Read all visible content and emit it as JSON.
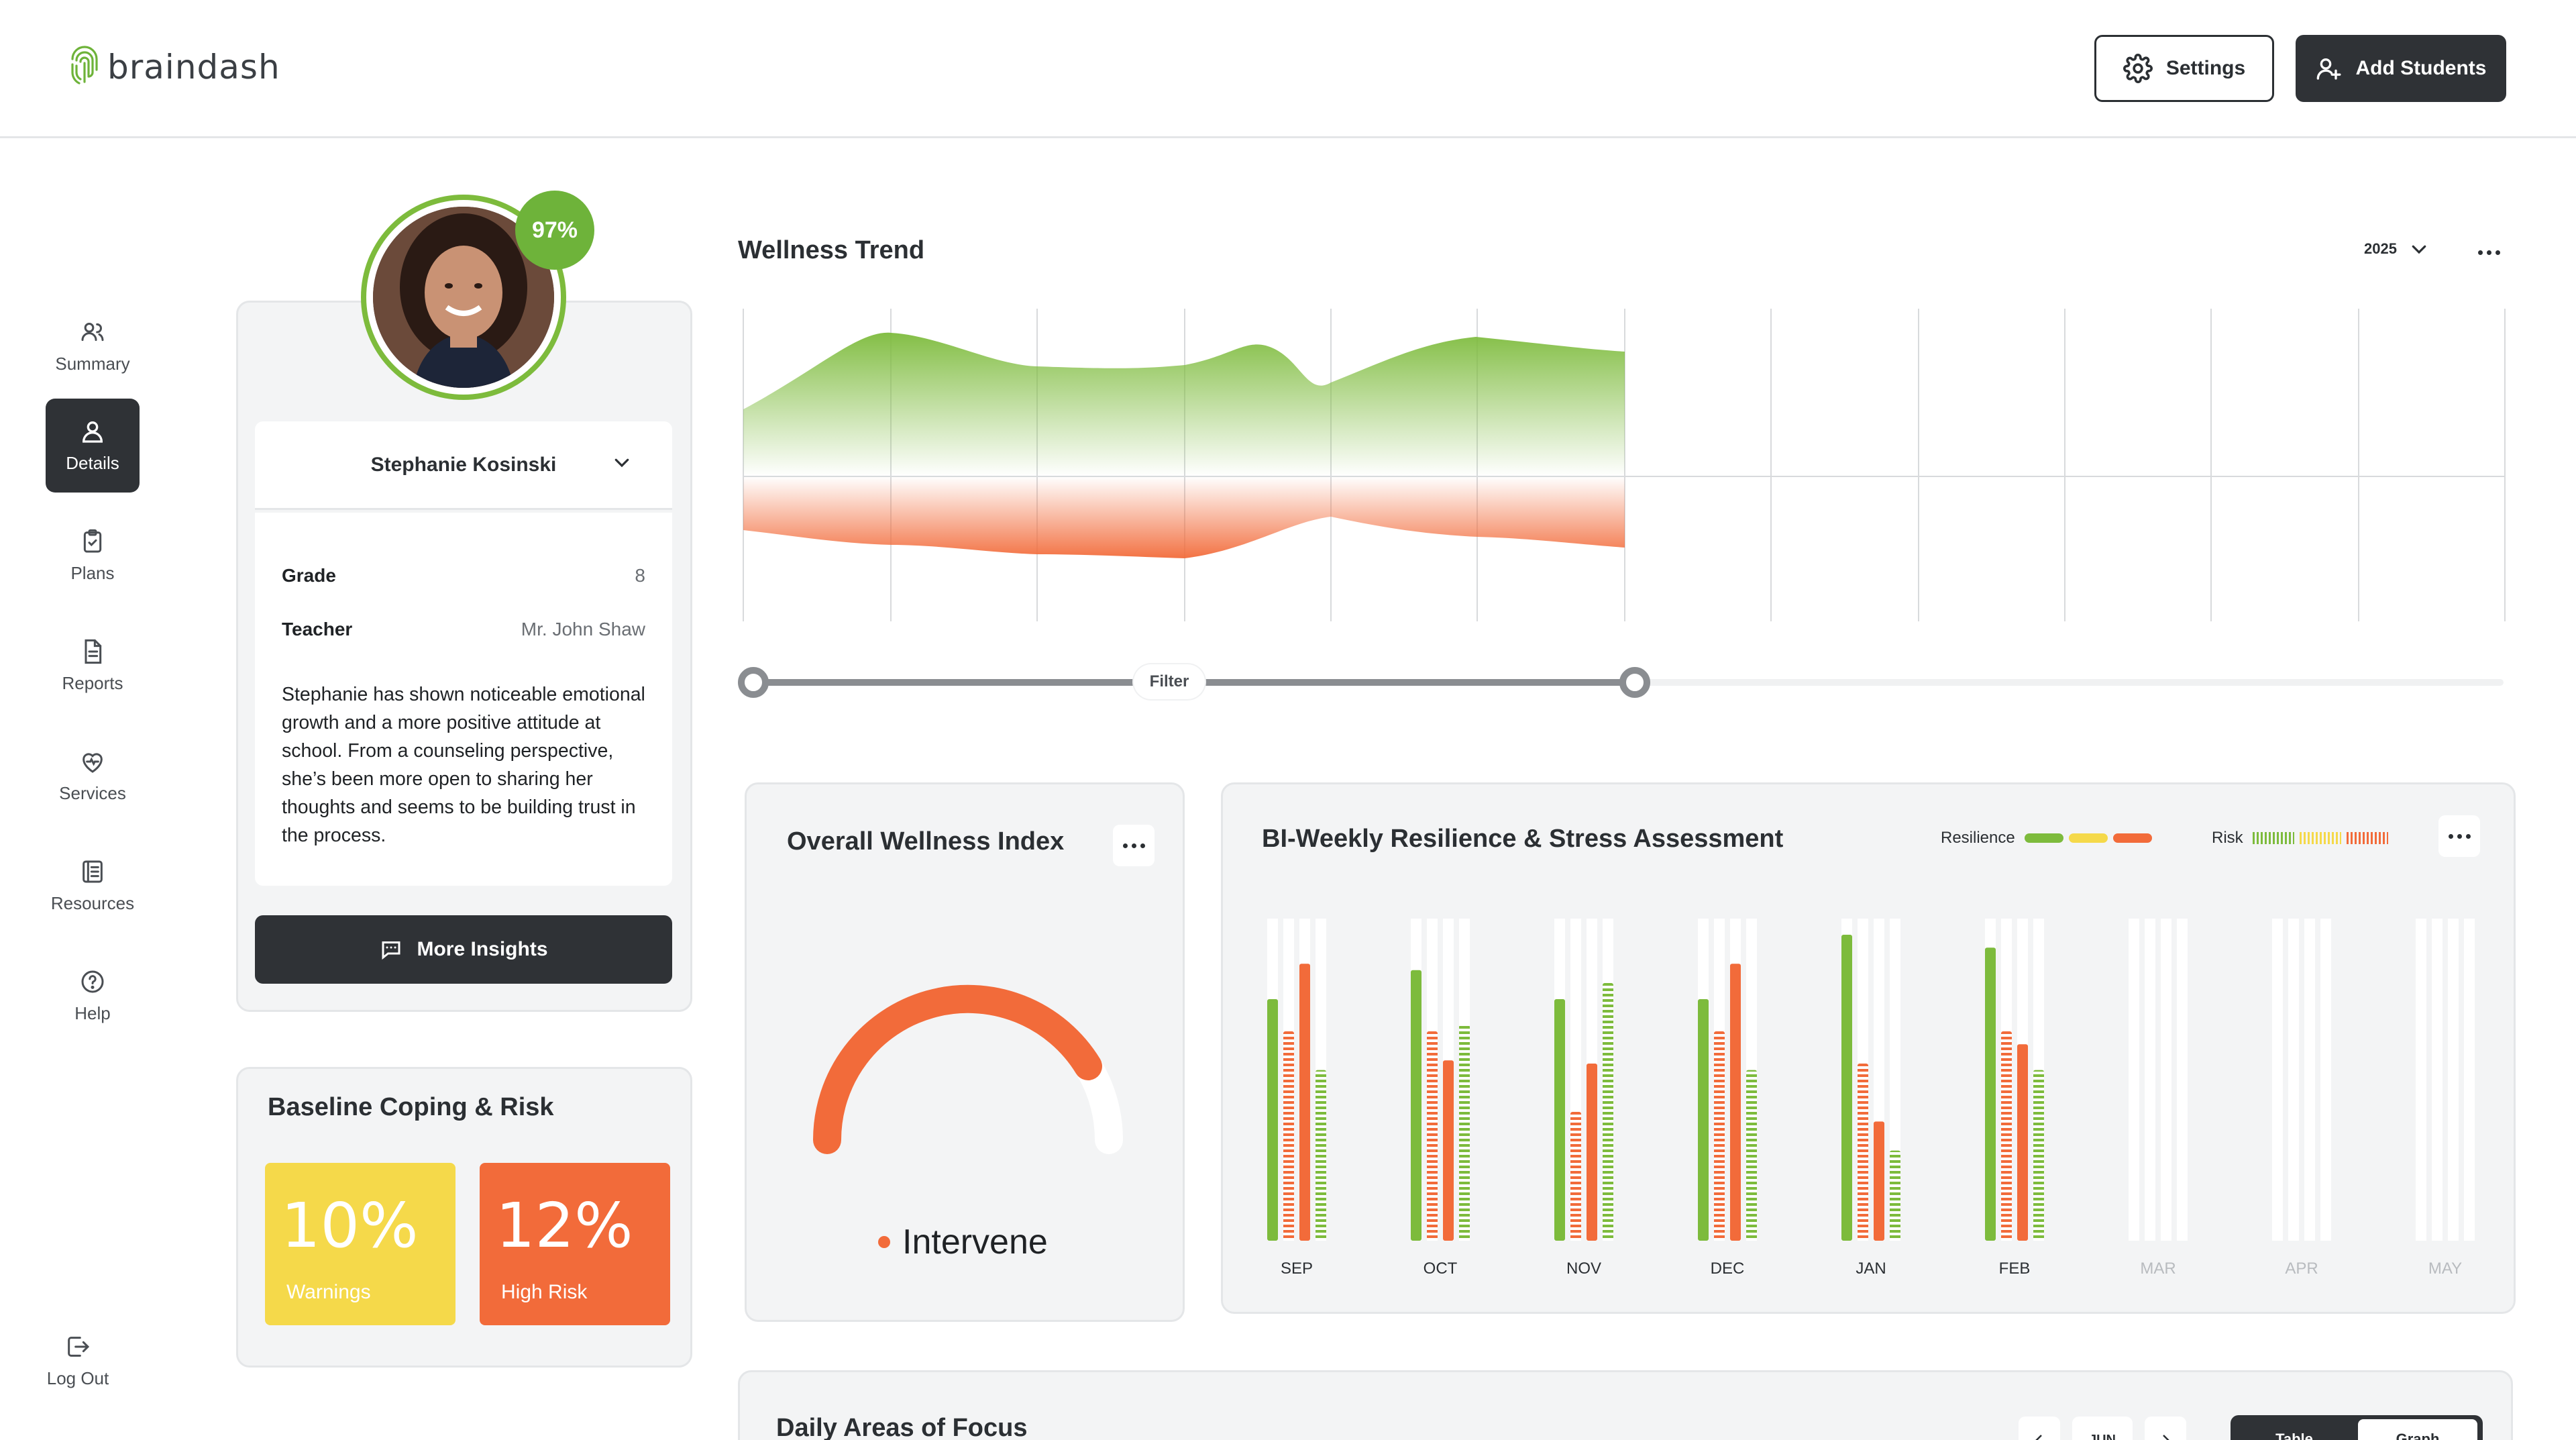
{
  "app": {
    "logo_text": "braindash",
    "settings_label": "Settings",
    "add_students_label": "Add Students"
  },
  "sidebar": {
    "items": [
      {
        "label": "Summary",
        "icon": "users-icon"
      },
      {
        "label": "Details",
        "icon": "user-icon",
        "active": true
      },
      {
        "label": "Plans",
        "icon": "clipboard-check-icon"
      },
      {
        "label": "Reports",
        "icon": "document-icon"
      },
      {
        "label": "Services",
        "icon": "heart-pulse-icon"
      },
      {
        "label": "Resources",
        "icon": "book-icon"
      },
      {
        "label": "Help",
        "icon": "help-icon"
      }
    ],
    "logout_label": "Log Out"
  },
  "profile": {
    "score": "97%",
    "name": "Stephanie Kosinski",
    "grade_label": "Grade",
    "grade_value": "8",
    "teacher_label": "Teacher",
    "teacher_value": "Mr. John Shaw",
    "bio": "Stephanie has shown noticeable emotional growth and a more positive attitude at school. From a counseling perspective, she’s been more open to sharing her thoughts and seems to be building trust in the process.",
    "insights_label": "More Insights"
  },
  "baseline": {
    "title": "Baseline Coping & Risk",
    "warnings_value": "10%",
    "warnings_label": "Warnings",
    "high_risk_value": "12%",
    "high_risk_label": "High Risk",
    "colors": {
      "warnings": "#f5d94a",
      "high_risk": "#f26b3a"
    }
  },
  "wellness_trend": {
    "title": "Wellness Trend",
    "year": "2025",
    "filter_label": "Filter",
    "colors": {
      "positive": "#7dbb3c",
      "negative": "#f26b3a"
    }
  },
  "overall_wellness": {
    "title": "Overall Wellness Index",
    "status": "Intervene",
    "level": 0.88,
    "color": "#f26b3a"
  },
  "resilience": {
    "title": "BI-Weekly Resilience & Stress Assessment",
    "legend_resilience": "Resilience",
    "legend_risk": "Risk",
    "colors": {
      "green": "#7dbb3c",
      "yellow": "#f5d94a",
      "orange": "#f26b3a"
    }
  },
  "chart_data": {
    "type": "bar",
    "categories": [
      "SEP",
      "OCT",
      "NOV",
      "DEC",
      "JAN",
      "FEB",
      "MAR",
      "APR",
      "MAY"
    ],
    "series": [
      {
        "name": "Resilience",
        "values": [
          0.75,
          0.84,
          0.75,
          0.75,
          0.95,
          0.91,
          null,
          null,
          null
        ]
      },
      {
        "name": "Risk",
        "values": [
          0.65,
          0.65,
          0.4,
          0.65,
          0.55,
          0.65,
          null,
          null,
          null
        ]
      },
      {
        "values": [
          0.86,
          0.56,
          0.55,
          0.86,
          0.37,
          0.61,
          null,
          null,
          null
        ]
      },
      {
        "values": [
          0.53,
          0.67,
          0.8,
          0.53,
          0.28,
          0.53,
          null,
          null,
          null
        ]
      }
    ],
    "ylim": [
      0,
      1
    ]
  },
  "daily_focus": {
    "title": "Daily Areas of Focus",
    "month": "JUN",
    "tab_table": "Table",
    "tab_graph": "Graph"
  }
}
